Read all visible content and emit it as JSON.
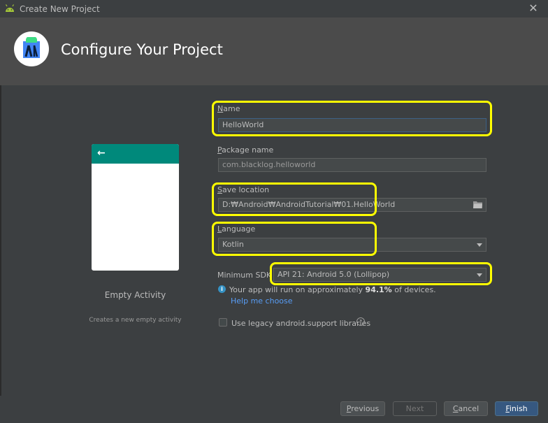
{
  "window": {
    "title": "Create New Project",
    "close_symbol": "✕"
  },
  "header": {
    "heading": "Configure Your Project",
    "logo_icon": "android-studio-logo-icon"
  },
  "template": {
    "name": "Empty Activity",
    "description": "Creates a new empty activity",
    "back_symbol": "←",
    "appbar_color": "#00897b"
  },
  "form": {
    "name": {
      "label": "Name",
      "mnemonic": "N",
      "label_rest": "ame",
      "value": "HelloWorld"
    },
    "package": {
      "label": "Package name",
      "mnemonic": "P",
      "label_rest": "ackage name",
      "value": "com.blacklog.helloworld"
    },
    "save_location": {
      "label": "Save location",
      "mnemonic": "S",
      "label_rest": "ave location",
      "value": "D:₩Android₩AndroidTutorial₩01.HelloWorld"
    },
    "language": {
      "label": "Language",
      "mnemonic": "L",
      "label_rest": "anguage",
      "value": "Kotlin"
    },
    "min_sdk": {
      "label": "Minimum SDK",
      "value": "API 21: Android 5.0 (Lollipop)"
    },
    "info": {
      "prefix": "Your app will run on approximately ",
      "percent": "94.1%",
      "suffix": " of devices."
    },
    "help_link": "Help me choose",
    "legacy_checkbox": {
      "label": "Use legacy android.support libraries",
      "checked": false
    }
  },
  "footer": {
    "previous": {
      "mnemonic": "P",
      "rest": "revious"
    },
    "next": "Next",
    "cancel": {
      "mnemonic": "C",
      "rest": "ancel"
    },
    "finish": {
      "mnemonic": "F",
      "rest": "inish"
    }
  },
  "colors": {
    "highlight": "#ffff00",
    "accent": "#365880",
    "link": "#589df6"
  }
}
